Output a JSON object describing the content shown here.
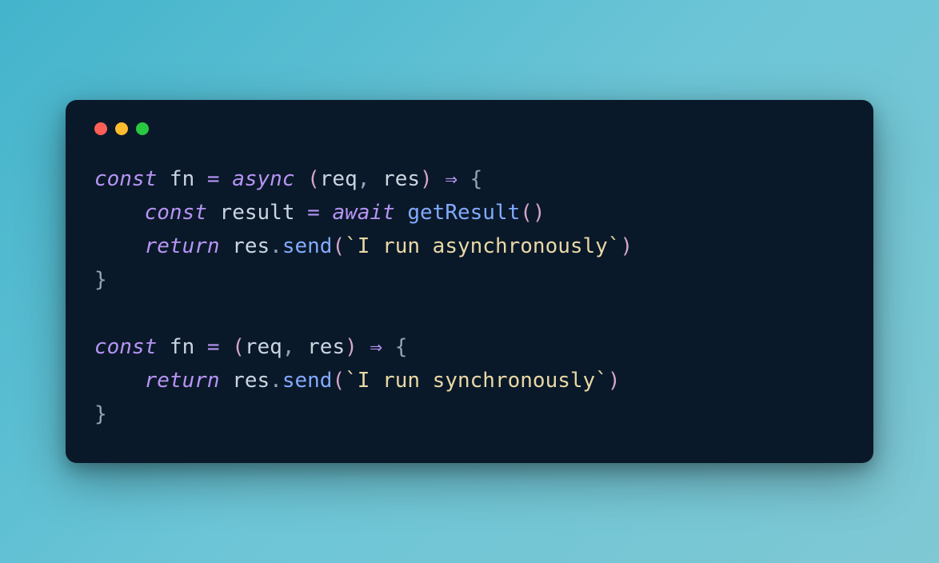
{
  "code": {
    "lines": [
      {
        "tokens": [
          {
            "t": "const ",
            "c": "kw"
          },
          {
            "t": "fn ",
            "c": "id"
          },
          {
            "t": "= ",
            "c": "op"
          },
          {
            "t": "async ",
            "c": "kw"
          },
          {
            "t": "(",
            "c": "paren"
          },
          {
            "t": "req",
            "c": "id"
          },
          {
            "t": ", ",
            "c": "punc"
          },
          {
            "t": "res",
            "c": "id"
          },
          {
            "t": ") ",
            "c": "paren"
          },
          {
            "t": "⇒ ",
            "c": "arrow"
          },
          {
            "t": "{",
            "c": "brace"
          }
        ]
      },
      {
        "tokens": [
          {
            "t": "    ",
            "c": "id"
          },
          {
            "t": "const ",
            "c": "kw"
          },
          {
            "t": "result ",
            "c": "id"
          },
          {
            "t": "= ",
            "c": "op"
          },
          {
            "t": "await ",
            "c": "kw"
          },
          {
            "t": "getResult",
            "c": "fnname"
          },
          {
            "t": "()",
            "c": "paren"
          }
        ]
      },
      {
        "tokens": [
          {
            "t": "    ",
            "c": "id"
          },
          {
            "t": "return ",
            "c": "kw"
          },
          {
            "t": "res",
            "c": "id"
          },
          {
            "t": ".",
            "c": "punc"
          },
          {
            "t": "send",
            "c": "fnname"
          },
          {
            "t": "(",
            "c": "paren"
          },
          {
            "t": "`I run asynchronously`",
            "c": "str"
          },
          {
            "t": ")",
            "c": "paren"
          }
        ]
      },
      {
        "tokens": [
          {
            "t": "}",
            "c": "brace"
          }
        ]
      },
      {
        "tokens": [
          {
            "t": " ",
            "c": "id"
          }
        ]
      },
      {
        "tokens": [
          {
            "t": "const ",
            "c": "kw"
          },
          {
            "t": "fn ",
            "c": "id"
          },
          {
            "t": "= ",
            "c": "op"
          },
          {
            "t": "(",
            "c": "paren"
          },
          {
            "t": "req",
            "c": "id"
          },
          {
            "t": ", ",
            "c": "punc"
          },
          {
            "t": "res",
            "c": "id"
          },
          {
            "t": ") ",
            "c": "paren"
          },
          {
            "t": "⇒ ",
            "c": "arrow"
          },
          {
            "t": "{",
            "c": "brace"
          }
        ]
      },
      {
        "tokens": [
          {
            "t": "    ",
            "c": "id"
          },
          {
            "t": "return ",
            "c": "kw"
          },
          {
            "t": "res",
            "c": "id"
          },
          {
            "t": ".",
            "c": "punc"
          },
          {
            "t": "send",
            "c": "fnname"
          },
          {
            "t": "(",
            "c": "paren"
          },
          {
            "t": "`I run synchronously`",
            "c": "str"
          },
          {
            "t": ")",
            "c": "paren"
          }
        ]
      },
      {
        "tokens": [
          {
            "t": "}",
            "c": "brace"
          }
        ]
      }
    ]
  }
}
